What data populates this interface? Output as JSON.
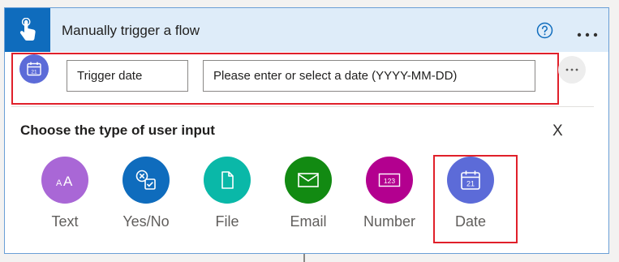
{
  "header": {
    "title": "Manually trigger a flow",
    "icon": "touch-hand-icon",
    "help_icon": "help-circle-icon",
    "more_icon": "more-horizontal-icon",
    "color": "#0f6cbd"
  },
  "param": {
    "name_value": "Trigger date",
    "description_value": "Please enter or select a date (YYYY-MM-DD)",
    "icon": "calendar-icon",
    "icon_color": "#5c6bd8"
  },
  "picker": {
    "title": "Choose the type of user input",
    "close_label": "X",
    "options": [
      {
        "label": "Text",
        "icon": "text-icon",
        "color": "#a967d6"
      },
      {
        "label": "Yes/No",
        "icon": "yes-no-icon",
        "color": "#0f6cbd"
      },
      {
        "label": "File",
        "icon": "file-icon",
        "color": "#0ab8a8"
      },
      {
        "label": "Email",
        "icon": "email-icon",
        "color": "#128a12"
      },
      {
        "label": "Number",
        "icon": "number-icon",
        "color": "#b3008f"
      },
      {
        "label": "Date",
        "icon": "calendar-icon",
        "color": "#5c6bd8"
      }
    ]
  },
  "highlight_color": "#e0202a"
}
